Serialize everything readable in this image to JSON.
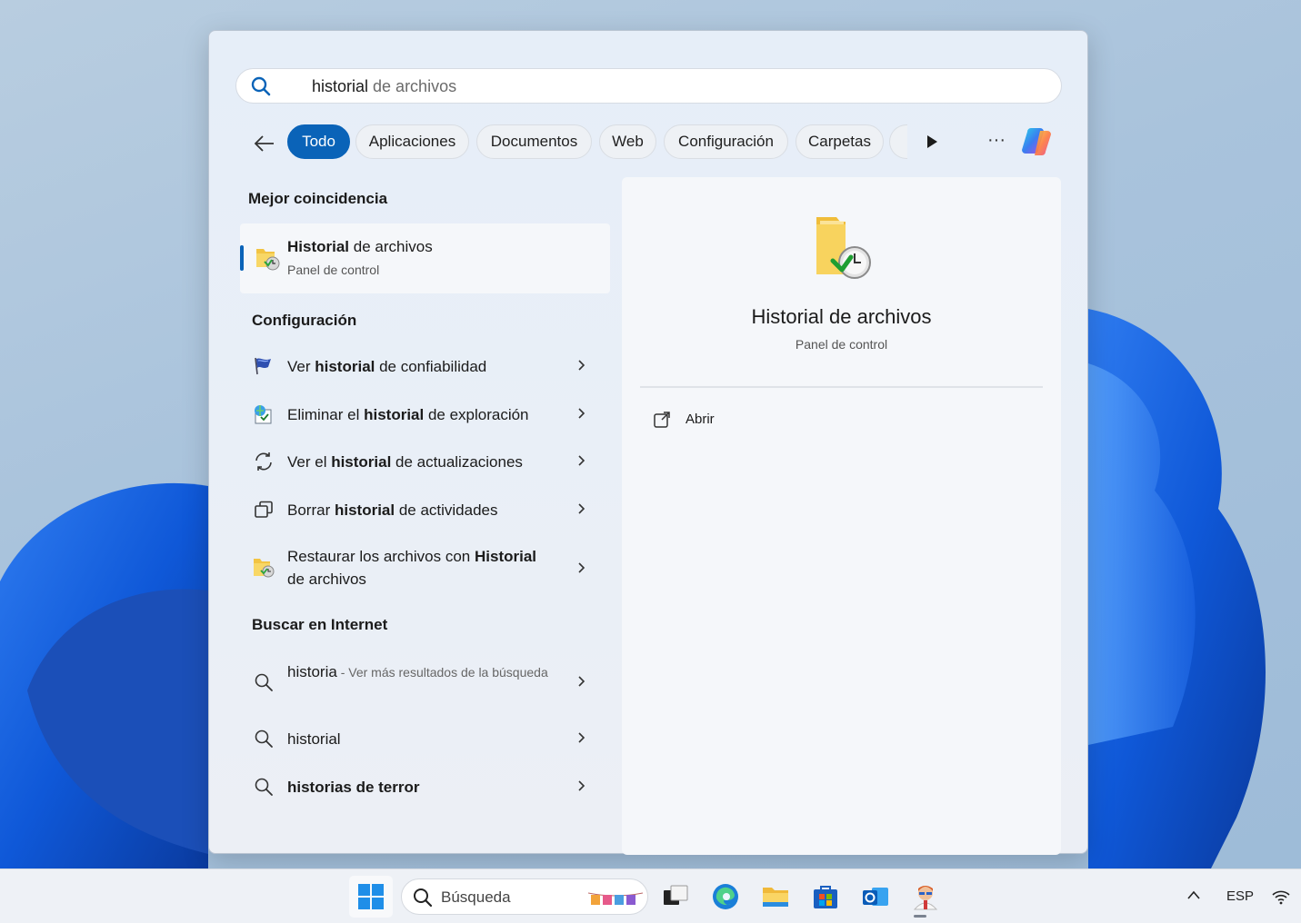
{
  "search": {
    "typed": "historial",
    "suggestion": " de archivos"
  },
  "filters": {
    "chips": [
      "Todo",
      "Aplicaciones",
      "Documentos",
      "Web",
      "Configuración",
      "Carpetas"
    ],
    "active": "Todo"
  },
  "best_match": {
    "section_title": "Mejor coincidencia",
    "title_bold": "Historial",
    "title_rest": " de archivos",
    "subtitle": "Panel de control"
  },
  "settings": {
    "section_title": "Configuración",
    "items": [
      {
        "pre": "Ver ",
        "bold": "historial",
        "post": " de confiabilidad",
        "icon": "reliability-flag-icon"
      },
      {
        "pre": "Eliminar el ",
        "bold": "historial",
        "post": " de exploración",
        "icon": "internet-options-icon"
      },
      {
        "pre": "Ver el ",
        "bold": "historial",
        "post": " de actualizaciones",
        "icon": "refresh-icon"
      },
      {
        "pre": "Borrar ",
        "bold": "historial",
        "post": " de actividades",
        "icon": "activity-icon"
      },
      {
        "pre": "Restaurar los archivos con ",
        "bold": "Historial",
        "post": " de archivos",
        "icon": "file-history-icon"
      }
    ]
  },
  "web": {
    "section_title": "Buscar en Internet",
    "items": [
      {
        "text": "historia",
        "sub": " - Ver más resultados de la búsqueda"
      },
      {
        "bold": "historial"
      },
      {
        "bold": "historias de terror"
      }
    ]
  },
  "detail": {
    "title": "Historial de archivos",
    "subtitle": "Panel de control",
    "action_open": "Abrir"
  },
  "taskbar": {
    "search_label": "Búsqueda",
    "language": "ESP"
  },
  "colors": {
    "accent": "#0a63b8"
  }
}
